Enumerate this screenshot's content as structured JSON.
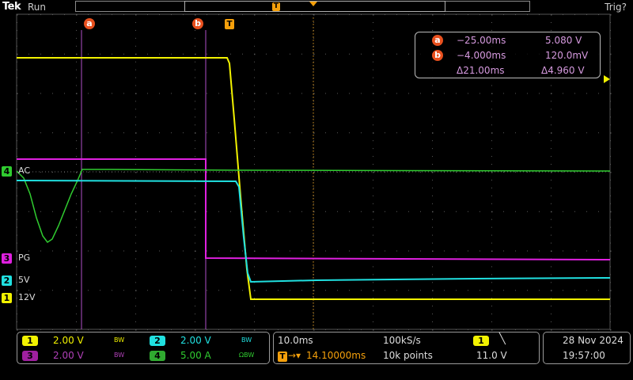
{
  "header": {
    "brand": "Tek",
    "run_state": "Run",
    "trigger_state": "Trig?",
    "timeline_trigger_marker": "T"
  },
  "colors": {
    "ch1": "#f2f200",
    "ch2": "#20e0e0",
    "ch3": "#e020e0",
    "ch4": "#30cc30",
    "cursor": "#b050c8",
    "cursor_tag": "#e8501e",
    "trigger": "#f5a00b",
    "grid": "#505050"
  },
  "channels": [
    {
      "id": "ch1",
      "number": "1",
      "label": "12V",
      "color": "#f2f200"
    },
    {
      "id": "ch2",
      "number": "2",
      "label": "5V",
      "color": "#20e0e0"
    },
    {
      "id": "ch3",
      "number": "3",
      "label": "PG",
      "color": "#e020e0"
    },
    {
      "id": "ch4",
      "number": "4",
      "label": "AC",
      "color": "#30cc30"
    }
  ],
  "cursors": {
    "a": {
      "tag": "a",
      "time": "−25.00ms",
      "value": "5.080 V"
    },
    "b": {
      "tag": "b",
      "time": "−4.000ms",
      "value": "120.0mV"
    },
    "delta_time": "Δ21.00ms",
    "delta_value": "Δ4.960 V",
    "trigger_tag": "T"
  },
  "vertical": {
    "ch1_number": "1",
    "ch1_scale": "2.00 V",
    "ch1_bw": "BW",
    "ch2_number": "2",
    "ch2_scale": "2.00 V",
    "ch2_bw": "BW",
    "ch3_number": "3",
    "ch3_scale": "2.00 V",
    "ch3_bw": "BW",
    "ch4_number": "4",
    "ch4_scale": "5.00 A",
    "ch4_bw": "ΩBW"
  },
  "horizontal": {
    "time_div": "10.0ms",
    "sample_rate": "100kS/s",
    "trigger_position": "14.10000ms",
    "record_length": "10k points"
  },
  "trigger": {
    "source": "1",
    "slope_icon": "falling-edge",
    "slope_glyph": "╲",
    "level": "11.0 V"
  },
  "datetime": {
    "date": "28 Nov 2024",
    "time": "19:57:00"
  }
}
